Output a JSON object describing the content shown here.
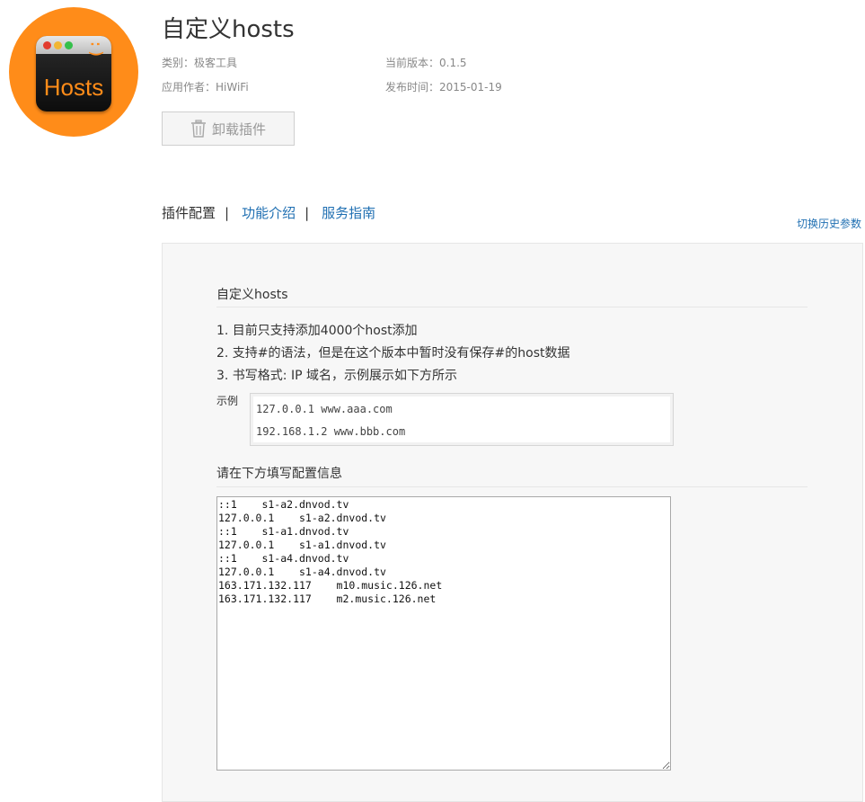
{
  "plugin": {
    "icon_text": "Hosts",
    "icon_smile": ":)",
    "title": "自定义hosts",
    "category": "类别：极客工具",
    "version": "当前版本：0.1.5",
    "author": "应用作者：HiWiFi",
    "release_date": "发布时间：2015-01-19",
    "uninstall_label": "卸载插件"
  },
  "tabs": [
    {
      "label": "插件配置",
      "active": true
    },
    {
      "label": "功能介绍",
      "active": false
    },
    {
      "label": "服务指南",
      "active": false
    }
  ],
  "tab_separator": "|",
  "history_link": "切换历史参数",
  "config": {
    "section_title": "自定义hosts",
    "notes": [
      "1. 目前只支持添加4000个host添加",
      "2. 支持#的语法，但是在这个版本中暂时没有保存#的host数据",
      "3. 书写格式: IP 域名，示例展示如下方所示"
    ],
    "example_label": "示例",
    "example_lines": [
      "127.0.0.1 www.aaa.com",
      "192.168.1.2 www.bbb.com"
    ],
    "input_title": "请在下方填写配置信息",
    "hosts_value": "::1    s1-a2.dnvod.tv\n127.0.0.1    s1-a2.dnvod.tv\n::1    s1-a1.dnvod.tv\n127.0.0.1    s1-a1.dnvod.tv\n::1    s1-a4.dnvod.tv\n127.0.0.1    s1-a4.dnvod.tv\n163.171.132.117    m10.music.126.net\n163.171.132.117    m2.music.126.net"
  },
  "colors": {
    "accent_orange": "#ff8c19",
    "link_blue": "#1f6fb2",
    "panel_bg": "#f7f7f7"
  }
}
